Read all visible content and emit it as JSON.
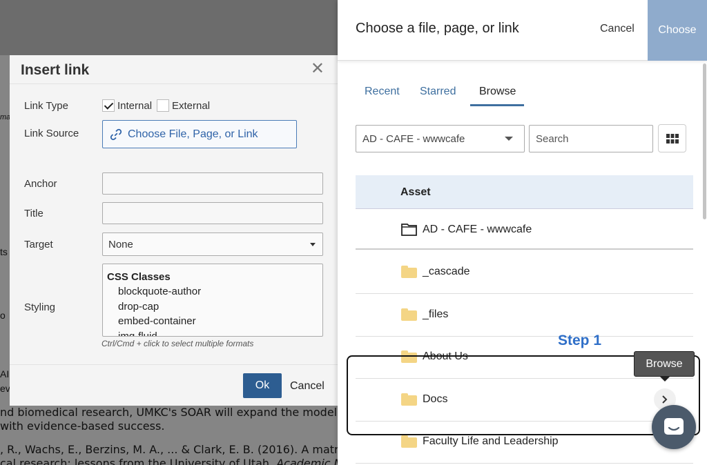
{
  "background": {
    "body_line_1": "nd biomedical research, UMKC's SOAR will expand the model to",
    "body_line_2": "with evidence-based success.",
    "citation_line_1": ", R., Wachs, E., Berzins, M. A., ... & Clark, E. B. (2016). A matri",
    "citation_line_2": "cal research: lessons from the University of Utah.",
    "citation_journal": "Academic Med",
    "frag_ma": "ma",
    "frag_ts": "ts",
    "frag_o": "o",
    "frag_al": "AI",
    "frag_ev": "ev"
  },
  "insert_link": {
    "title": "Insert link",
    "close_icon": "close-icon",
    "link_type_label": "Link Type",
    "internal_label": "Internal",
    "internal_checked": true,
    "external_label": "External",
    "external_checked": false,
    "link_source_label": "Link Source",
    "link_source_button": "Choose File, Page, or Link",
    "anchor_label": "Anchor",
    "anchor_value": "",
    "title_label": "Title",
    "title_value": "",
    "target_label": "Target",
    "target_value": "None",
    "styling_label": "Styling",
    "styling_group": "CSS Classes",
    "styling_options": [
      "blockquote-author",
      "drop-cap",
      "embed-container",
      "img-fluid"
    ],
    "styling_hint": "Ctrl/Cmd + click to select multiple formats",
    "ok_label": "Ok",
    "cancel_label": "Cancel"
  },
  "chooser": {
    "title": "Choose a file, page, or link",
    "cancel_label": "Cancel",
    "choose_label": "Choose",
    "tabs": [
      {
        "label": "Recent",
        "active": false
      },
      {
        "label": "Starred",
        "active": false
      },
      {
        "label": "Browse",
        "active": true
      }
    ],
    "site_select_value": "AD - CAFE - wwwcafe",
    "search_placeholder": "Search",
    "grid_view_icon": "grid-icon",
    "column_header": "Asset",
    "root_folder": "AD - CAFE - wwwcafe",
    "folders": [
      "_cascade",
      "_files",
      "About Us",
      "Docs",
      "Faculty Life and Leadership"
    ]
  },
  "annotations": {
    "step_label": "Step 1",
    "tooltip": "Browse"
  },
  "colors": {
    "accent_blue": "#3e6f9f",
    "choose_button": "#8fabcc",
    "ok_button": "#2d5d91",
    "folder_yellow": "#f4d585",
    "table_header_bg": "#e6eef7",
    "step_label": "#2f6fc8"
  }
}
